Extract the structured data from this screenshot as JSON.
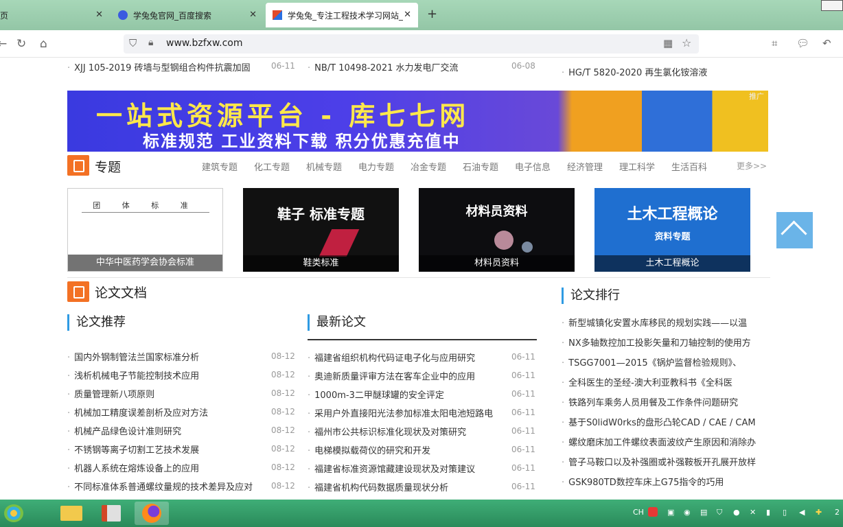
{
  "browser": {
    "tabs": [
      {
        "label": "页",
        "active": false
      },
      {
        "label": "学兔兔官网_百度搜索",
        "active": false
      },
      {
        "label": "学兔兔_专注工程技术学习网站_",
        "active": true
      }
    ],
    "url": "www.bzfxw.com"
  },
  "top_list": {
    "left": {
      "text": "XJJ 105-2019 砖墙与型钢组合构件抗震加固",
      "date": "06-11"
    },
    "middle": {
      "text": "NB/T 10498-2021 水力发电厂交流",
      "date": "06-08"
    },
    "right": {
      "text": "HG/T 5820-2020 再生氯化铵溶液"
    }
  },
  "banner": {
    "line1": "一站式资源平台 - 库七七网",
    "line2": "标准规范 工业资料下载 积分优惠充值中",
    "tag": "推广"
  },
  "topics": {
    "title": "专题",
    "links": [
      "建筑专题",
      "化工专题",
      "机械专题",
      "电力专题",
      "冶金专题",
      "石油专题",
      "电子信息",
      "经济管理",
      "理工科学",
      "生活百科",
      "更多>>"
    ],
    "cards": [
      {
        "caption": "中华中医药学会协会标准",
        "art": "团 体 标 准"
      },
      {
        "caption": "鞋类标准",
        "art": "鞋子 标准专题"
      },
      {
        "caption": "材料员资料",
        "art": "材料员资料"
      },
      {
        "caption": "土木工程概论",
        "art": "土木工程概论",
        "art_sub": "资料专题"
      }
    ]
  },
  "papers": {
    "title": "论文文档",
    "recommend_title": "论文推荐",
    "latest_title": "最新论文",
    "ranking_title": "论文排行",
    "recommend": [
      {
        "text": "国内外钢制管法兰国家标准分析",
        "date": "08-12"
      },
      {
        "text": "浅析机械电子节能控制技术应用",
        "date": "08-12"
      },
      {
        "text": "质量管理新八项原则",
        "date": "08-12"
      },
      {
        "text": "机械加工精度误差剖析及应对方法",
        "date": "08-12"
      },
      {
        "text": "机械产品绿色设计准则研究",
        "date": "08-12"
      },
      {
        "text": "不锈钢等离子切割工艺技术发展",
        "date": "08-12"
      },
      {
        "text": "机器人系统在熔炼设备上的应用",
        "date": "08-12"
      },
      {
        "text": "不同标准体系普通螺纹量规的技术差异及应对",
        "date": "08-12"
      }
    ],
    "latest": [
      {
        "text": "福建省组织机构代码证电子化与应用研究",
        "date": "06-11"
      },
      {
        "text": "奥迪新质量评审方法在客车企业中的应用",
        "date": "06-11"
      },
      {
        "text": "1000m-3二甲醚球罐的安全评定",
        "date": "06-11"
      },
      {
        "text": "采用户外直接阳光法参加标准太阳电池短路电",
        "date": "06-11"
      },
      {
        "text": "福州市公共标识标准化现状及对策研究",
        "date": "06-11"
      },
      {
        "text": "电梯模拟载荷仪的研究和开发",
        "date": "06-11"
      },
      {
        "text": "福建省标准资源馆藏建设现状及对策建议",
        "date": "06-11"
      },
      {
        "text": "福建省机构代码数据质量现状分析",
        "date": "06-11"
      }
    ],
    "ranking": [
      "新型城镇化安置水库移民的规划实践——以温",
      "NX多轴数控加工投影矢量和刀轴控制的使用方",
      "TSGG7001—2015《锅炉监督检验规则》、",
      "全科医生的圣经-澳大利亚教科书《全科医",
      "铁路列车乘务人员用餐及工作条件问题研究",
      "基于S0lidW0rks的盘形凸轮CAD / CAE / CAM",
      "螺纹磨床加工件螺纹表面波纹产生原因和消除办",
      "管子马鞍口以及补强圈或补强鞍板开孔展开放样",
      "GSK980TD数控车床上G75指令的巧用"
    ]
  },
  "tray": {
    "lang": "CH",
    "clock": "2"
  }
}
